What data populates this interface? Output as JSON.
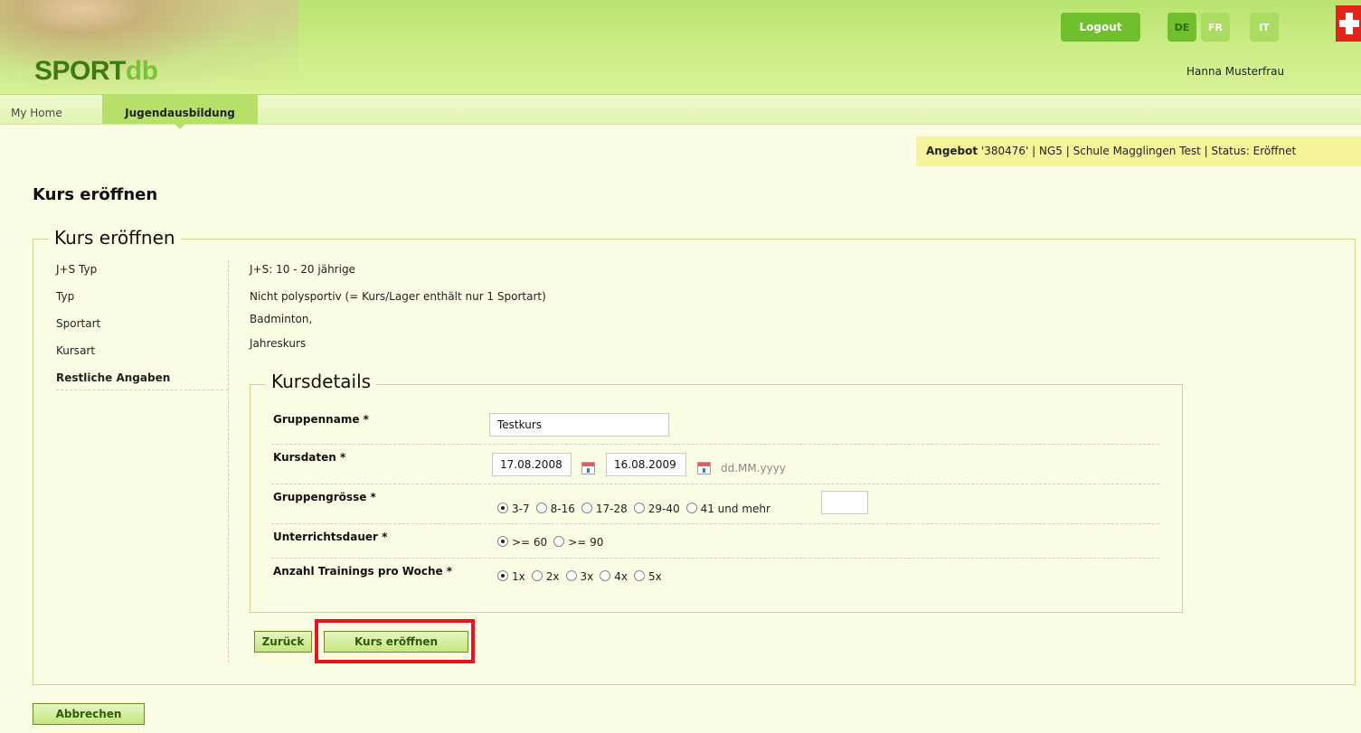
{
  "header": {
    "logo_main": "SPORT",
    "logo_suffix": "db",
    "logout_label": "Logout",
    "languages": [
      "DE",
      "FR",
      "IT"
    ],
    "active_language": "DE",
    "user_name": "Hanna Musterfrau"
  },
  "nav": {
    "items": [
      "My Home",
      "Jugendausbildung"
    ],
    "active": "Jugendausbildung"
  },
  "angebot_bar": {
    "label": "Angebot",
    "text": " '380476' | NG5 | Schule Magglingen Test | Status: Eröffnet"
  },
  "page": {
    "title": "Kurs eröffnen",
    "section_title": "Kurs eröffnen"
  },
  "steps": [
    {
      "label": "J+S Typ",
      "value": "J+S: 10 - 20 jährige"
    },
    {
      "label": "Typ",
      "value": "Nicht polysportiv (= Kurs/Lager enthält nur 1 Sportart)"
    },
    {
      "label": "Sportart",
      "value": "Badminton,"
    },
    {
      "label": "Kursart",
      "value": "Jahreskurs"
    },
    {
      "label": "Restliche Angaben"
    }
  ],
  "kursdetails": {
    "title": "Kursdetails",
    "gruppenname": {
      "label": "Gruppenname *",
      "value": "Testkurs"
    },
    "kursdaten": {
      "label": "Kursdaten *",
      "from": "17.08.2008",
      "to": "16.08.2009",
      "format": "dd.MM.yyyy"
    },
    "gruppengroesse": {
      "label": "Gruppengrösse *",
      "options": [
        "3-7",
        "8-16",
        "17-28",
        "29-40",
        "41 und mehr"
      ],
      "selected": "3-7",
      "extra_value": ""
    },
    "unterrichtsdauer": {
      "label": "Unterrichtsdauer *",
      "options": [
        ">= 60",
        ">= 90"
      ],
      "selected": ">= 60"
    },
    "trainings": {
      "label": "Anzahl Trainings pro Woche *",
      "options": [
        "1x",
        "2x",
        "3x",
        "4x",
        "5x"
      ],
      "selected": "1x"
    }
  },
  "buttons": {
    "back": "Zurück",
    "submit": "Kurs eröffnen",
    "cancel": "Abbrechen"
  },
  "colors": {
    "header_green": "#b9e470",
    "accent_green": "#6fc02c",
    "highlight_red": "#e8141a",
    "angebot_yellow": "#f7f59a"
  }
}
